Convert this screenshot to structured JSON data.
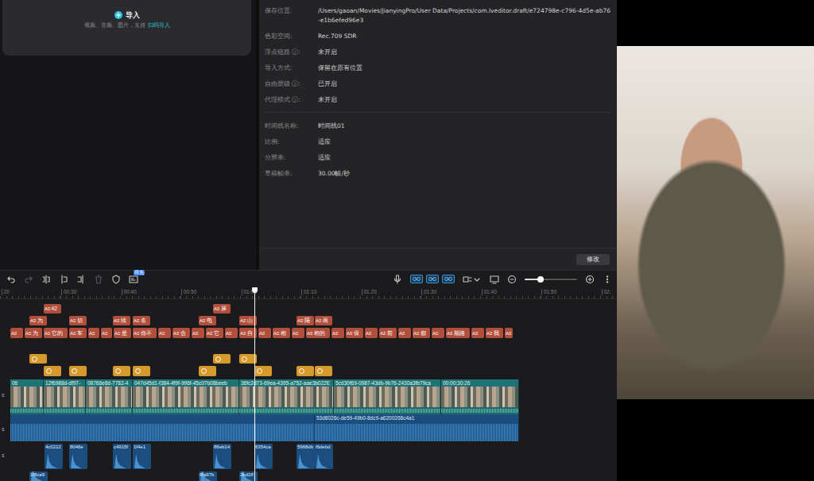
{
  "media_panel": {
    "import_label": "导入",
    "import_hint": "视频、音频、图片，支持",
    "scan_import": "扫码导入"
  },
  "properties": {
    "rows": [
      {
        "label": "保存位置:",
        "value": "/Users/gaoan/Movies/JianyingPro/User Data/Projects/com.lveditor.draft/e724798e-c796-4d5e-ab76-e1b6efed96e3"
      },
      {
        "label": "色彩空间:",
        "value": "Rec.709 SDR"
      },
      {
        "label": "浮点链路 ⓘ:",
        "value": "未开启"
      },
      {
        "label": "导入方式:",
        "value": "保留在原有位置"
      },
      {
        "label": "自由层级 ⓘ:",
        "value": "已开启"
      },
      {
        "label": "代理模式 ⓘ:",
        "value": "未开启"
      }
    ],
    "timeline_rows": [
      {
        "label": "时间线名称:",
        "value": "时间线01"
      },
      {
        "label": "比例:",
        "value": "适应"
      },
      {
        "label": "分辨率:",
        "value": "适应"
      },
      {
        "label": "草稿帧率:",
        "value": "30.00帧/秒"
      }
    ],
    "modify": "修改"
  },
  "timeline": {
    "toolbar": {
      "badge": "限免",
      "toggles": [
        {
          "on": true
        },
        {
          "on": true
        },
        {
          "on": true
        }
      ],
      "zoom": {
        "level": 0.3
      }
    },
    "ruler": [
      "20",
      "00:30",
      "00:40",
      "00:50",
      "01:00",
      "01:10",
      "01:20",
      "01:30",
      "01:40",
      "01:50",
      "02:"
    ],
    "playhead": {
      "level": 0.413
    },
    "text_icon": "A≡",
    "track_labels": [
      "s",
      "s",
      "s"
    ],
    "text_tracks": [
      [
        {
          "label": "42"
        },
        {
          "label": "屏"
        }
      ],
      [
        {
          "label": "为"
        },
        {
          "label": "切"
        },
        {
          "label": "续"
        },
        {
          "label": "名"
        },
        {
          "label": "电"
        },
        {
          "label": "山"
        },
        {
          "label": "隔"
        },
        {
          "label": "两"
        }
      ],
      [
        {},
        {
          "label": "为"
        },
        {
          "label": "它的"
        },
        {
          "label": "车"
        },
        {},
        {},
        {
          "label": "是"
        },
        {
          "label": "你不"
        },
        {},
        {
          "label": "合"
        },
        {},
        {
          "label": "它"
        },
        {},
        {
          "label": "自"
        },
        {},
        {
          "label": "相"
        },
        {},
        {
          "label": "相的"
        },
        {},
        {
          "label": "保"
        },
        {},
        {
          "label": "前"
        },
        {},
        {
          "label": "都"
        },
        {},
        {
          "label": "期路"
        },
        {},
        {
          "label": "我"
        },
        {}
      ]
    ],
    "video": [
      {
        "label": "06"
      },
      {
        "label": "12f6988d-df97-"
      },
      {
        "label": "08766e8d-7782-4"
      },
      {
        "label": "047d45d1-f384-4f9f-996f-45c07b08beeb"
      },
      {
        "label": "36fc2d73-69ea-4395-a752-aae3b022E"
      },
      {
        "label": "5cd30f69-0987-43db-9b76-2430a3fb79ca"
      },
      {
        "label": "00:00:30:26"
      }
    ],
    "audio": [
      {},
      {
        "label": "53d8026c-de59-49b0-8dc9-a6200268c4a1"
      }
    ],
    "sfx": [
      {
        "label": "4c0212"
      },
      {
        "label": "8046e"
      },
      {
        "label": "c4915f"
      },
      {
        "label": "1f4e1"
      },
      {
        "label": "86eb14"
      },
      {
        "label": "6354ca"
      },
      {
        "label": "5968db"
      },
      {
        "label": "f6debd"
      }
    ],
    "sfx2": [
      {
        "label": "1f8ca9"
      },
      {
        "label": "8fa97b"
      },
      {
        "label": "2bd1ff"
      }
    ]
  }
}
